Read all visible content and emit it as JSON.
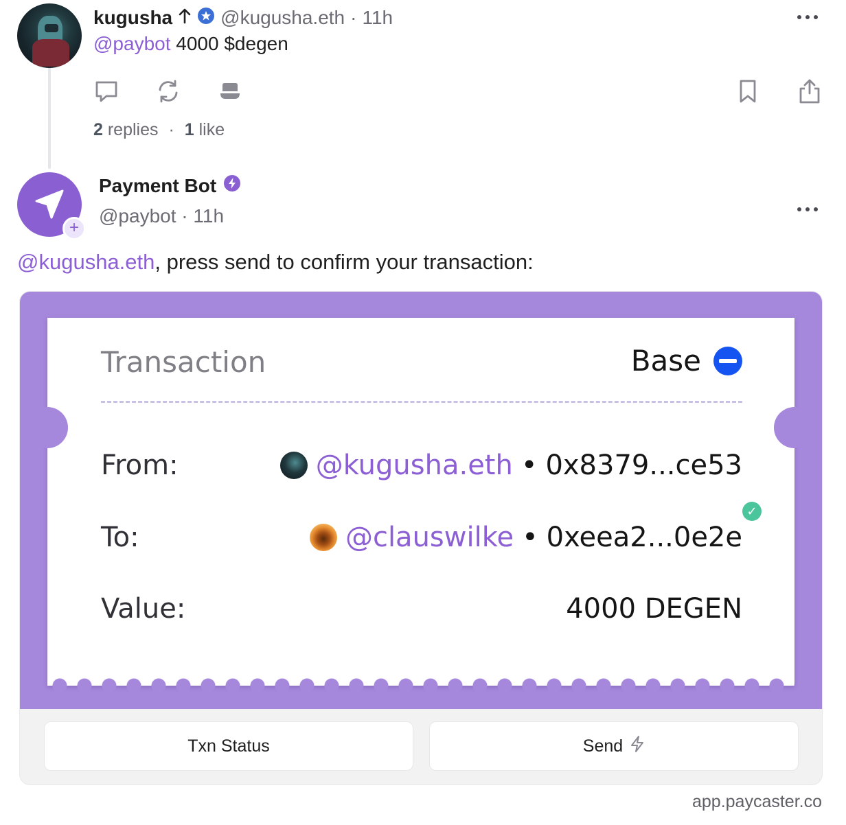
{
  "post1": {
    "author_name": "kugusha",
    "author_handle": "@kugusha.eth",
    "time": "11h",
    "separator": "·",
    "mention": "@paybot",
    "body": " 4000 $degen",
    "stats": {
      "replies_count": "2",
      "replies_label": "replies",
      "likes_count": "1",
      "likes_label": "like",
      "separator": "·"
    },
    "icons": [
      "reply-icon",
      "recast-icon",
      "tip-icon",
      "bookmark-icon",
      "share-icon",
      "more-icon",
      "arrow-up-icon",
      "verified-badge-icon"
    ]
  },
  "post2": {
    "author_name": "Payment Bot",
    "author_handle": "@paybot",
    "time": "11h",
    "separator": "·",
    "mention": "@kugusha.eth",
    "body": ", press send to confirm your transaction:",
    "follow_symbol": "+"
  },
  "frame": {
    "ticket": {
      "title": "Transaction",
      "chain": "Base",
      "from_label": "From:",
      "from_handle": "@kugusha.eth",
      "from_address": "0x8379...ce53",
      "to_label": "To:",
      "to_handle": "@clauswilke",
      "to_address": "0xeea2...0e2e",
      "value_label": "Value:",
      "value": "4000 DEGEN",
      "bullet": "•"
    },
    "buttons": {
      "status_label": "Txn Status",
      "send_label": "Send"
    },
    "domain": "app.paycaster.co"
  },
  "colors": {
    "accent": "#8c5fd4",
    "frame_bg": "#a587dc",
    "base_blue": "#1554f0",
    "verified_check": "#4bc59b"
  }
}
